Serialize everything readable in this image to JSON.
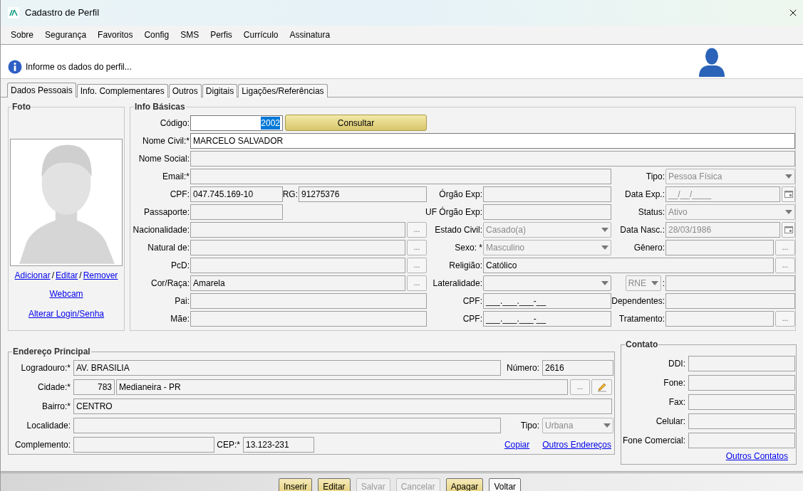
{
  "window": {
    "title": "Cadastro de Perfil"
  },
  "menu": [
    "Sobre",
    "Segurança",
    "Favoritos",
    "Config",
    "SMS",
    "Perfis",
    "Currículo",
    "Assinatura"
  ],
  "header": {
    "message": "Informe os dados do perfil..."
  },
  "tabs": [
    {
      "label": "Dados Pessoais",
      "selected": true
    },
    {
      "label": "Info. Complementares",
      "selected": false
    },
    {
      "label": "Outros",
      "selected": false
    },
    {
      "label": "Digitais",
      "selected": false
    },
    {
      "label": "Ligações/Referências",
      "selected": false
    }
  ],
  "foto": {
    "title": "Foto",
    "actions": [
      "Adicionar",
      "Editar",
      "Remover"
    ],
    "separator": "/",
    "links": [
      "Webcam",
      "Alterar Login/Senha"
    ]
  },
  "info_basicas": {
    "title": "Info Básicas",
    "items": [
      {
        "kind": "text",
        "label": "Código:",
        "value": "2002",
        "editable": true,
        "text_selected": true
      },
      {
        "kind": "button",
        "label": "Consultar"
      },
      {
        "kind": "text",
        "label": "Nome Civil:*",
        "value": "MARCELO SALVADOR",
        "editable": true
      },
      {
        "kind": "text",
        "label": "Nome Social:"
      },
      {
        "kind": "text",
        "label": "Email:*"
      },
      {
        "kind": "select",
        "label": "Tipo:",
        "value": "Pessoa Física",
        "disabled": true
      },
      {
        "kind": "text",
        "label": "CPF:",
        "value": "047.745.169-10"
      },
      {
        "kind": "text",
        "label": "RG:",
        "value": "91275376"
      },
      {
        "kind": "text",
        "label": "Órgão Exp:"
      },
      {
        "kind": "date",
        "label": "Data Exp.:",
        "value": "__/__/____",
        "disabled": true
      },
      {
        "kind": "text",
        "label": "Passaporte:"
      },
      {
        "kind": "text",
        "label": "UF Órgão Exp:"
      },
      {
        "kind": "select",
        "label": "Status:",
        "value": "Ativo",
        "disabled": true
      },
      {
        "kind": "lookup",
        "label": "Nacionalidade:",
        "button": "..."
      },
      {
        "kind": "select",
        "label": "Estado Civil:",
        "value": "Casado(a)",
        "disabled": true
      },
      {
        "kind": "date",
        "label": "Data Nasc.:",
        "value": "28/03/1986",
        "disabled": true
      },
      {
        "kind": "lookup",
        "label": "Natural de:",
        "button": "..."
      },
      {
        "kind": "select",
        "label": "Sexo: *",
        "value": "Masculino",
        "disabled": true
      },
      {
        "kind": "lookup",
        "label": "Gênero:",
        "button": "..."
      },
      {
        "kind": "lookup",
        "label": "PcD:",
        "button": "..."
      },
      {
        "kind": "lookup",
        "label": "Religião:",
        "value": "Católico",
        "button": "..."
      },
      {
        "kind": "lookup",
        "label": "Cor/Raça:",
        "value": "Amarela",
        "button": "..."
      },
      {
        "kind": "select",
        "label": "Lateralidade:",
        "disabled": false
      },
      {
        "kind": "typed",
        "option": "RNE",
        "separator": ":",
        "disabled": true
      },
      {
        "kind": "text",
        "label": "Pai:"
      },
      {
        "kind": "text",
        "label": "CPF:",
        "value": "___.___.___-__"
      },
      {
        "kind": "text",
        "label": "Dependentes:"
      },
      {
        "kind": "text",
        "label": "Mãe:"
      },
      {
        "kind": "text",
        "label": "CPF:",
        "value": "___.___.___-__"
      },
      {
        "kind": "lookup",
        "label": "Tratamento:",
        "button": "..."
      }
    ]
  },
  "endereco": {
    "title": "Endereço Principal",
    "items": [
      {
        "kind": "text",
        "label": "Logradouro:*",
        "value": "AV. BRASILIA"
      },
      {
        "kind": "text",
        "label": "Número:",
        "value": "2616"
      },
      {
        "kind": "city",
        "label": "Cidade:*",
        "code": "783",
        "value": "Medianeira - PR",
        "button": "..."
      },
      {
        "kind": "text",
        "label": "Bairro:*",
        "value": "CENTRO"
      },
      {
        "kind": "text",
        "label": "Localidade:"
      },
      {
        "kind": "select",
        "label": "Tipo:",
        "value": "Urbana",
        "disabled": true
      },
      {
        "kind": "text",
        "label": "Complemento:"
      },
      {
        "kind": "text",
        "label": "CEP:*",
        "value": "13.123-231"
      }
    ],
    "links": [
      "Copiar",
      "Outros Endereços"
    ]
  },
  "contato": {
    "title": "Contato",
    "fields": [
      "DDI:",
      "Fone:",
      "Fax:",
      "Celular:",
      "Fone Comercial:"
    ],
    "link": "Outros Contatos"
  },
  "buttons": [
    {
      "label": "Inserir",
      "disabled": false,
      "highlighted": true
    },
    {
      "label": "Editar",
      "disabled": false,
      "highlighted": true
    },
    {
      "label": "Salvar",
      "disabled": true,
      "highlighted": false
    },
    {
      "label": "Cancelar",
      "disabled": true,
      "highlighted": false
    },
    {
      "label": "Apagar",
      "disabled": false,
      "highlighted": true
    },
    {
      "label": "Voltar",
      "disabled": false,
      "highlighted": false
    }
  ]
}
